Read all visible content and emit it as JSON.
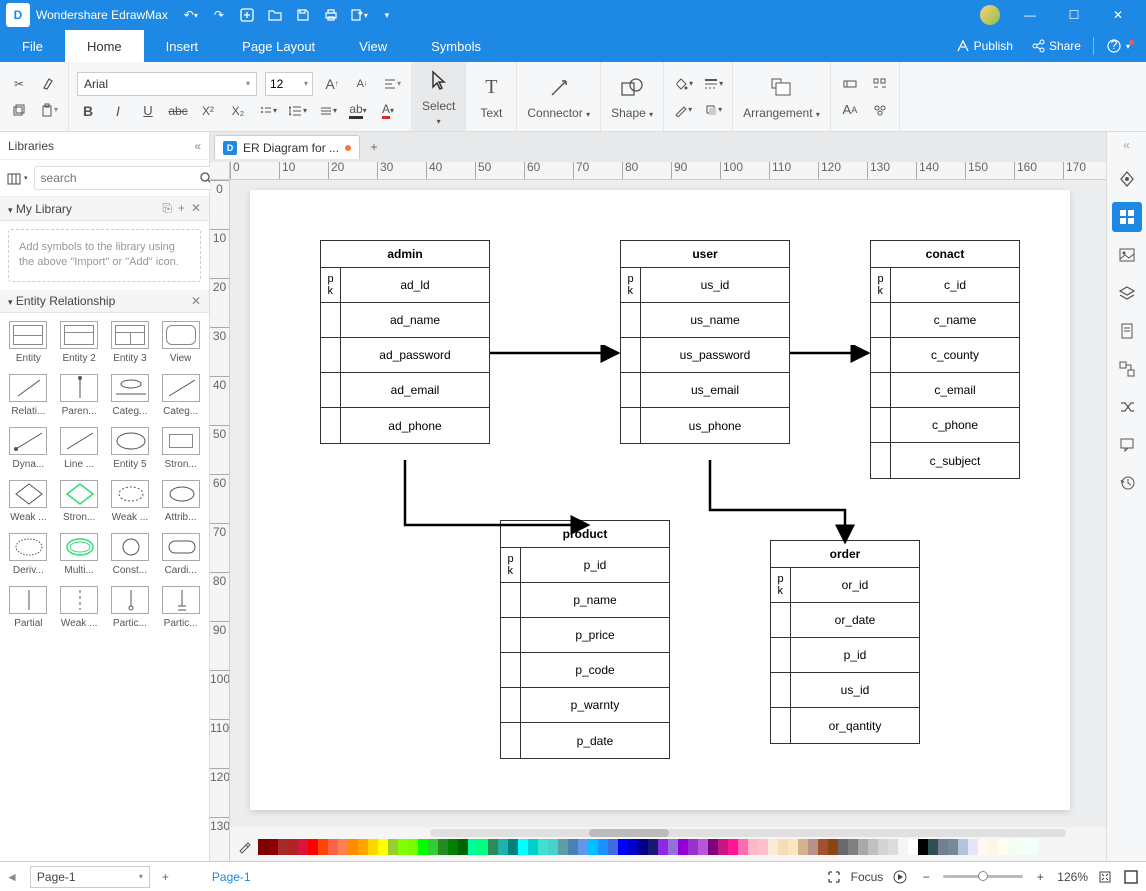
{
  "app": {
    "name": "Wondershare EdrawMax"
  },
  "menu": {
    "file": "File",
    "home": "Home",
    "insert": "Insert",
    "page": "Page Layout",
    "view": "View",
    "symbols": "Symbols",
    "publish": "Publish",
    "share": "Share"
  },
  "ribbon": {
    "font": "Arial",
    "size": "12",
    "select": "Select",
    "text": "Text",
    "connector": "Connector",
    "shape": "Shape",
    "arrangement": "Arrangement"
  },
  "sidebar": {
    "title": "Libraries",
    "search_placeholder": "search",
    "mylib": "My Library",
    "hint": "Add symbols to the library using the above \"Import\" or \"Add\" icon.",
    "ersect": "Entity Relationship",
    "shapes": [
      "Entity",
      "Entity 2",
      "Entity 3",
      "View",
      "Relati...",
      "Paren...",
      "Categ...",
      "Categ...",
      "Dyna...",
      "Line ...",
      "Entity 5",
      "Stron...",
      "Weak ...",
      "Stron...",
      "Weak ...",
      "Attrib...",
      "Deriv...",
      "Multi...",
      "Const...",
      "Cardi...",
      "Partial",
      "Weak ...",
      "Partic...",
      "Partic..."
    ]
  },
  "tab": {
    "name": "ER Diagram for ..."
  },
  "entities": {
    "admin": {
      "title": "admin",
      "pk": "p k",
      "fields": [
        "ad_ld",
        "ad_name",
        "ad_password",
        "ad_email",
        "ad_phone"
      ]
    },
    "user": {
      "title": "user",
      "pk": "p k",
      "fields": [
        "us_id",
        "us_name",
        "us_password",
        "us_email",
        "us_phone"
      ]
    },
    "contact": {
      "title": "conact",
      "pk": "p k",
      "fields": [
        "c_id",
        "c_name",
        "c_county",
        "c_email",
        "c_phone",
        "c_subject"
      ]
    },
    "product": {
      "title": "product",
      "pk": "p k",
      "fields": [
        "p_id",
        "p_name",
        "p_price",
        "p_code",
        "p_warnty",
        "p_date"
      ]
    },
    "order": {
      "title": "order",
      "pk": "p k",
      "fields": [
        "or_id",
        "or_date",
        "p_id",
        "us_id",
        "or_qantity"
      ]
    }
  },
  "status": {
    "page": "Page-1",
    "pagelink": "Page-1",
    "focus": "Focus",
    "zoom": "126%"
  },
  "hruler": [
    0,
    10,
    20,
    30,
    40,
    50,
    60,
    70,
    80,
    90,
    100,
    110,
    120,
    130,
    140,
    150,
    160,
    170
  ],
  "vruler": [
    0,
    10,
    20,
    30,
    40,
    50,
    60,
    70,
    80,
    90,
    100,
    110,
    120,
    130
  ]
}
